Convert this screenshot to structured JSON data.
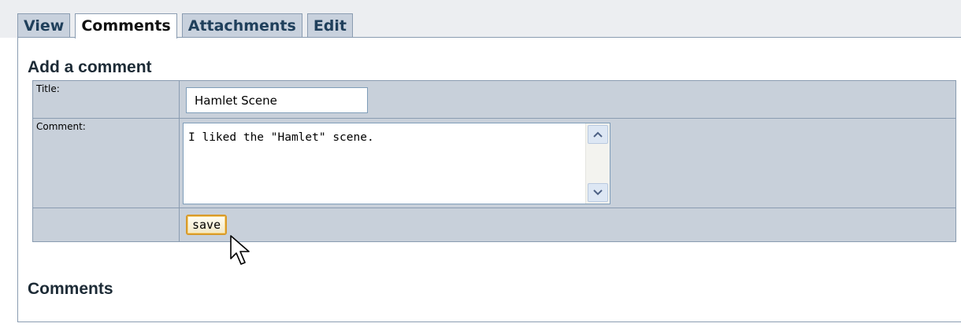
{
  "tabs": [
    {
      "label": "View",
      "active": false
    },
    {
      "label": "Comments",
      "active": true
    },
    {
      "label": "Attachments",
      "active": false
    },
    {
      "label": "Edit",
      "active": false
    }
  ],
  "add_comment": {
    "heading": "Add a comment",
    "title_label": "Title:",
    "title_value": "Hamlet Scene",
    "comment_label": "Comment:",
    "comment_value": "I liked the \"Hamlet\" scene.",
    "save_label": "save"
  },
  "comments_section": {
    "heading": "Comments"
  },
  "colors": {
    "tab_bg": "#c8d1dd",
    "tab_text": "#1f3f5b",
    "form_bg": "#c8d0da",
    "border": "#8a9cb1",
    "save_border": "#d89a2a"
  },
  "icons": [
    "scroll-up-arrow-icon",
    "scroll-down-arrow-icon",
    "mouse-pointer-icon"
  ]
}
